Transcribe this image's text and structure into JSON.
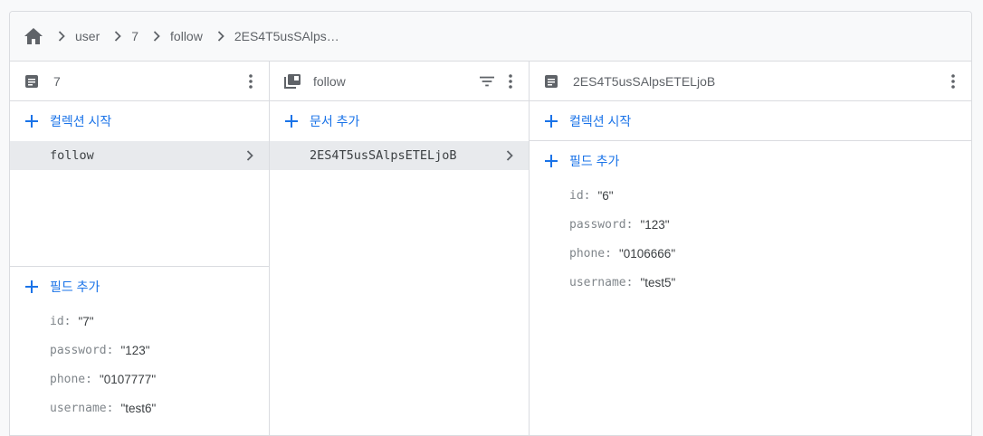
{
  "breadcrumb": {
    "items": [
      "user",
      "7",
      "follow",
      "2ES4T5usSAlps…"
    ]
  },
  "columns": [
    {
      "title": "7",
      "add_collection_label": "컬렉션 시작",
      "items": [
        {
          "label": "follow",
          "selected": true
        }
      ],
      "add_field_label": "필드 추가",
      "fields": [
        {
          "key": "id",
          "value": "\"7\""
        },
        {
          "key": "password",
          "value": "\"123\""
        },
        {
          "key": "phone",
          "value": "\"0107777\""
        },
        {
          "key": "username",
          "value": "\"test6\""
        }
      ]
    },
    {
      "title": "follow",
      "add_document_label": "문서 추가",
      "items": [
        {
          "label": "2ES4T5usSAlpsETELjoB",
          "selected": true
        }
      ]
    },
    {
      "title": "2ES4T5usSAlpsETELjoB",
      "add_collection_label": "컬렉션 시작",
      "add_field_label": "필드 추가",
      "fields": [
        {
          "key": "id",
          "value": "\"6\""
        },
        {
          "key": "password",
          "value": "\"123\""
        },
        {
          "key": "phone",
          "value": "\"0106666\""
        },
        {
          "key": "username",
          "value": "\"test5\""
        }
      ]
    }
  ],
  "colors": {
    "accent": "#1a73e8",
    "selected_bg": "#e8eaed",
    "border": "#dadce0"
  },
  "icons": [
    "home-icon",
    "chevron-right-icon",
    "document-icon",
    "collection-icon",
    "more-vert-icon",
    "filter-icon",
    "plus-icon"
  ]
}
